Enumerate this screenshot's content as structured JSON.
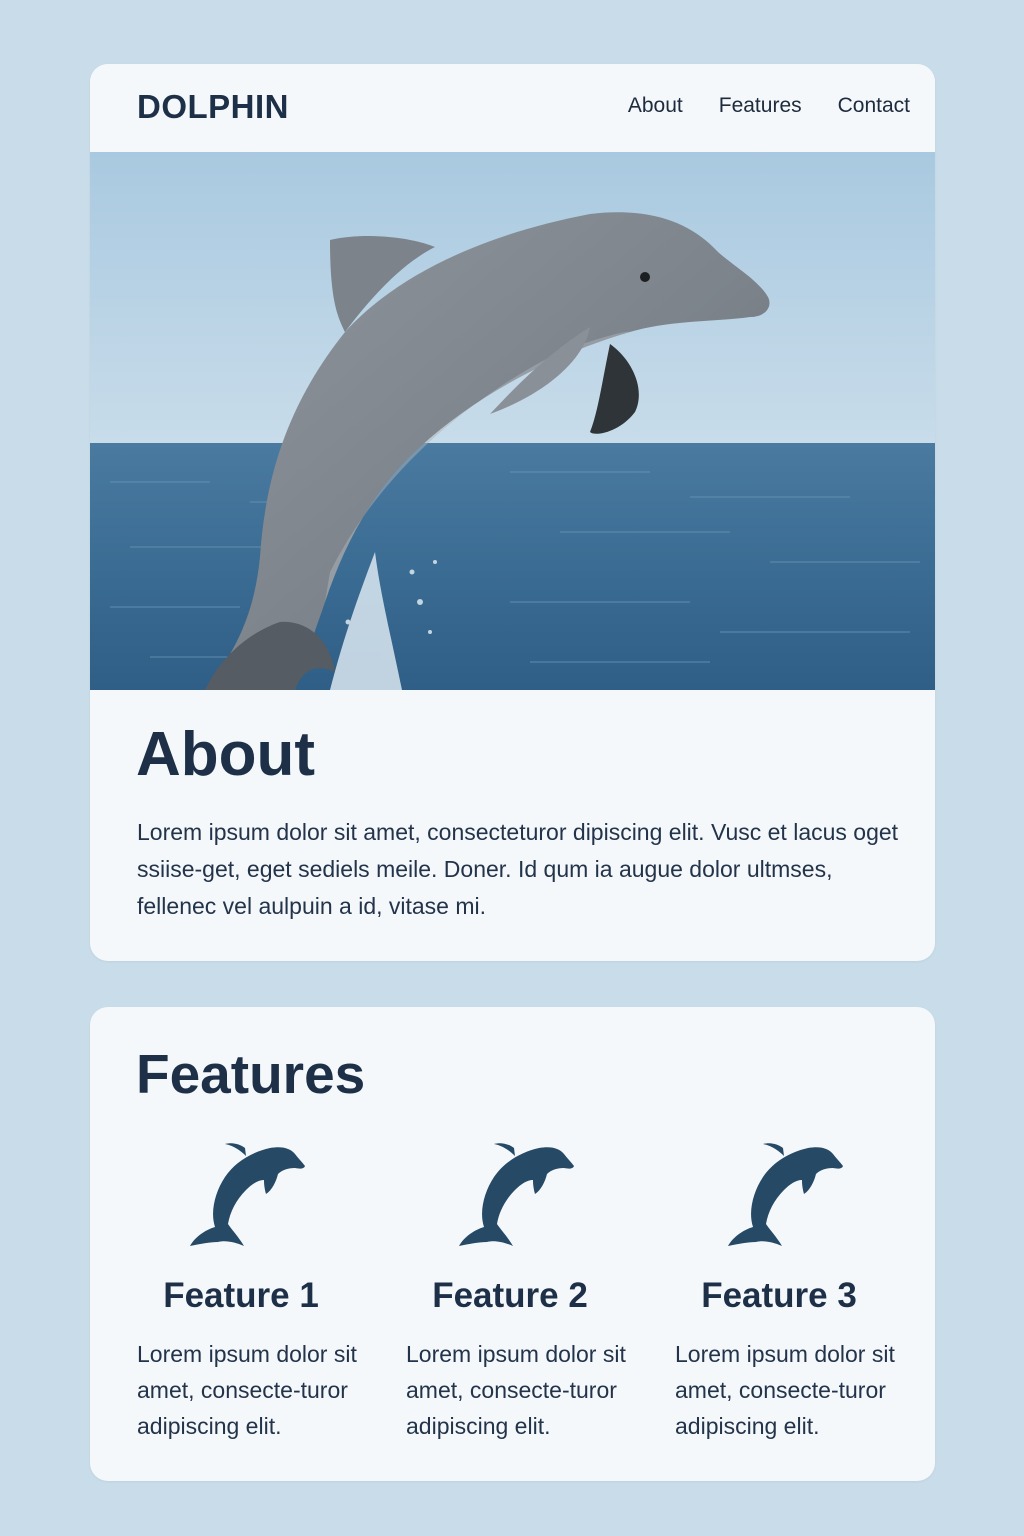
{
  "header": {
    "logo": "DOLPHIN",
    "nav": [
      "About",
      "Features",
      "Contact"
    ]
  },
  "hero": {
    "image": "dolphin-jumping-out-of-sea"
  },
  "about": {
    "title": "About",
    "text": "Lorem ipsum dolor sit amet, consecteturor dipiscing elit. Vusc et lacus oget ssiise-get, eget sediels meile. Doner. Id qum ia augue dolor ultmses, fellenec vel aulpuin a id, vitase mi."
  },
  "features": {
    "title": "Features",
    "items": [
      {
        "icon": "dolphin-icon",
        "title": "Feature 1",
        "text": "Lorem ipsum dolor sit amet, consecte-turor adipiscing elit."
      },
      {
        "icon": "dolphin-icon",
        "title": "Feature 2",
        "text": "Lorem ipsum dolor sit amet, consecte-turor adipiscing elit."
      },
      {
        "icon": "dolphin-icon",
        "title": "Feature 3",
        "text": "Lorem ipsum dolor sit amet, consecte-turor adipiscing elit."
      }
    ]
  },
  "colors": {
    "page_background": "#c9dce9",
    "card_background": "#f5f8fb",
    "heading": "#1d3048",
    "icon": "#264a66",
    "sky": "#b9d3e6",
    "sea": "#3e6f96"
  }
}
